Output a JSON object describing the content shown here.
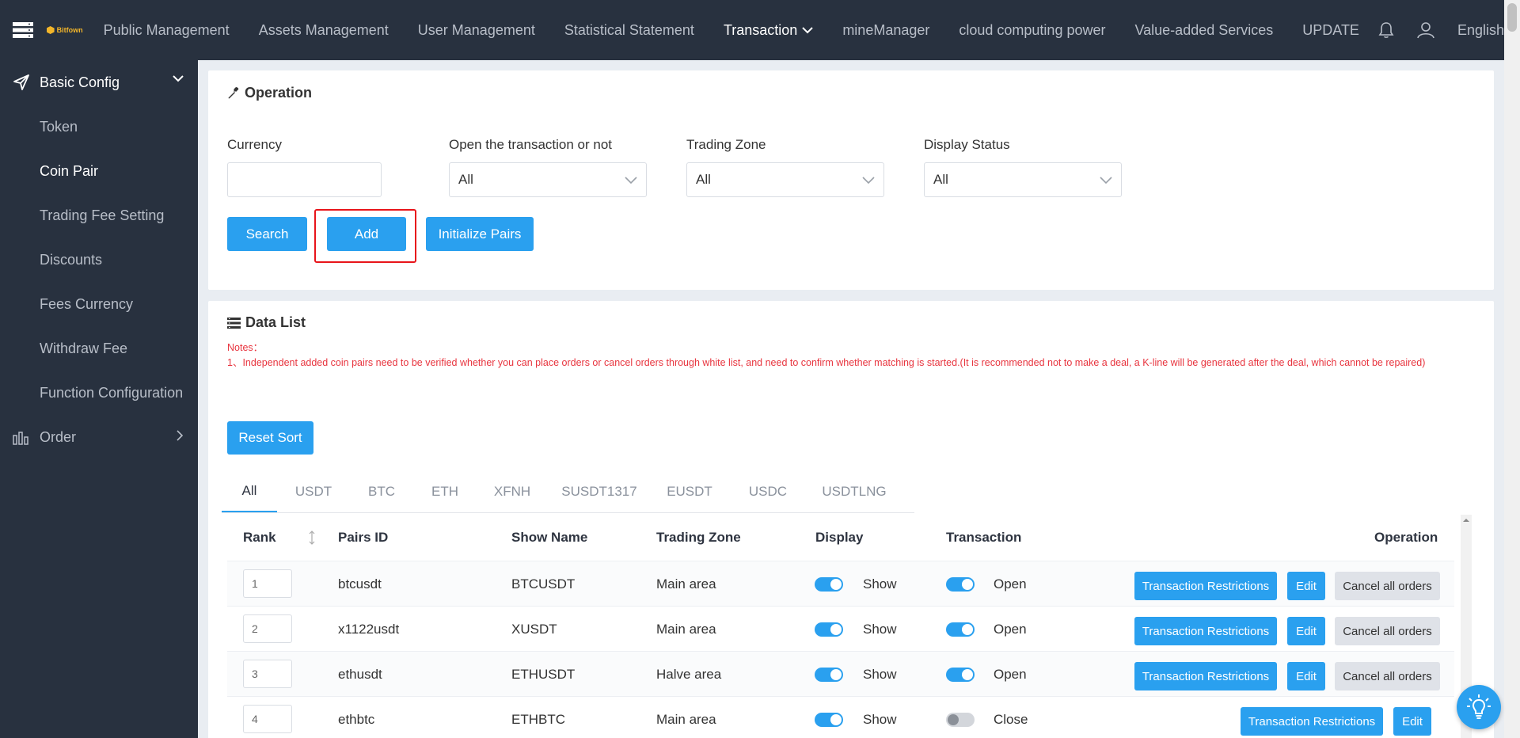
{
  "header": {
    "logo_text": "Bitfown",
    "nav": [
      "Public Management",
      "Assets Management",
      "User Management",
      "Statistical Statement",
      "Transaction",
      "mineManager",
      "cloud computing power",
      "Value-added Services",
      "UPDATE"
    ],
    "language": "English"
  },
  "sidebar": {
    "group_basic": "Basic Config",
    "items": [
      "Token",
      "Coin Pair",
      "Trading Fee Setting",
      "Discounts",
      "Fees Currency",
      "Withdraw Fee",
      "Function Configuration"
    ],
    "group_order": "Order"
  },
  "operation": {
    "title": "Operation",
    "currency_label": "Currency",
    "currency_value": "",
    "open_label": "Open the transaction or not",
    "open_value": "All",
    "zone_label": "Trading Zone",
    "zone_value": "All",
    "display_label": "Display Status",
    "display_value": "All",
    "search_btn": "Search",
    "add_btn": "Add",
    "init_btn": "Initialize Pairs"
  },
  "datalist": {
    "title": "Data List",
    "notes_title": "Notes：",
    "notes_text": "1、Independent added coin pairs need to be verified whether you can place orders or cancel orders through white list, and need to confirm whether matching is started.(It is recommended not to make a deal, a K-line will be generated after the deal, which cannot be repaired)",
    "reset_sort": "Reset Sort",
    "tabs": [
      "All",
      "USDT",
      "BTC",
      "ETH",
      "XFNH",
      "SUSDT1317",
      "EUSDT",
      "USDC",
      "USDTLNG"
    ],
    "columns": {
      "rank": "Rank",
      "pairs_id": "Pairs ID",
      "show_name": "Show Name",
      "trading_zone": "Trading Zone",
      "display": "Display",
      "transaction": "Transaction",
      "operation": "Operation"
    },
    "rows": [
      {
        "rank": "1",
        "pairs_id": "btcusdt",
        "show_name": "BTCUSDT",
        "zone": "Main area",
        "display": "Show",
        "transaction": "Open"
      },
      {
        "rank": "2",
        "pairs_id": "x1122usdt",
        "show_name": "XUSDT",
        "zone": "Main area",
        "display": "Show",
        "transaction": "Open"
      },
      {
        "rank": "3",
        "pairs_id": "ethusdt",
        "show_name": "ETHUSDT",
        "zone": "Halve area",
        "display": "Show",
        "transaction": "Open"
      },
      {
        "rank": "4",
        "pairs_id": "ethbtc",
        "show_name": "ETHBTC",
        "zone": "Main area",
        "display": "Show",
        "transaction": "Close"
      }
    ],
    "btn_restrictions": "Transaction Restrictions",
    "btn_edit": "Edit",
    "btn_cancel_orders": "Cancel all orders"
  }
}
